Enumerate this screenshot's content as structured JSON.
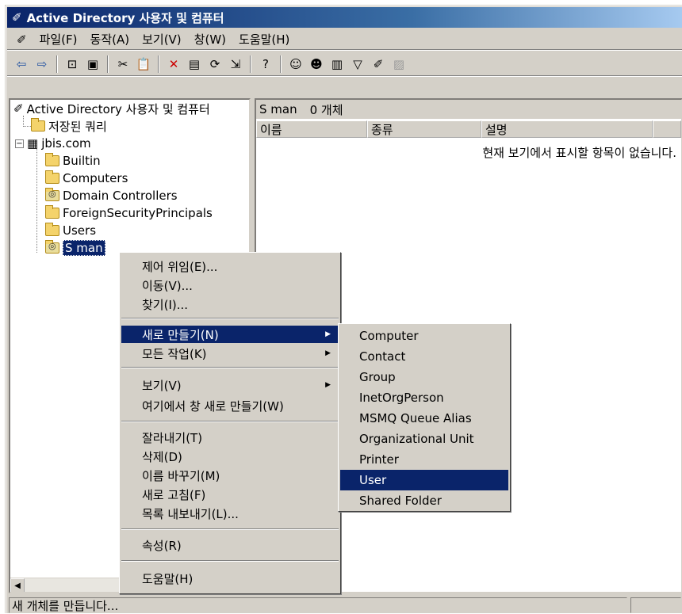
{
  "window": {
    "title": "Active Directory 사용자 및 컴퓨터"
  },
  "menubar": [
    "파일(F)",
    "동작(A)",
    "보기(V)",
    "창(W)",
    "도움말(H)"
  ],
  "tree": {
    "root": "Active Directory 사용자 및 컴퓨터",
    "saved_queries": "저장된 쿼리",
    "domain": "jbis.com",
    "children": [
      "Builtin",
      "Computers",
      "Domain Controllers",
      "ForeignSecurityPrincipals",
      "Users",
      "S man"
    ]
  },
  "rightpane": {
    "container_name": "S man",
    "object_count": "0 개체",
    "columns": [
      "이름",
      "종류",
      "설명"
    ],
    "empty_message": "현재 보기에서 표시할 항목이 없습니다."
  },
  "context_menu": {
    "items": [
      "제어 위임(E)...",
      "이동(V)...",
      "찾기(I)...",
      "새로 만들기(N)",
      "모든 작업(K)",
      "보기(V)",
      "여기에서 창 새로 만들기(W)",
      "잘라내기(T)",
      "삭제(D)",
      "이름 바꾸기(M)",
      "새로 고침(F)",
      "목록 내보내기(L)...",
      "속성(R)",
      "도움말(H)"
    ]
  },
  "submenu": {
    "items": [
      "Computer",
      "Contact",
      "Group",
      "InetOrgPerson",
      "MSMQ Queue Alias",
      "Organizational Unit",
      "Printer",
      "User",
      "Shared Folder"
    ],
    "selected": "User"
  },
  "statusbar": {
    "text": "새 개체를 만듭니다..."
  },
  "colors": {
    "selection": "#0a246a",
    "face": "#d4d0c8"
  }
}
